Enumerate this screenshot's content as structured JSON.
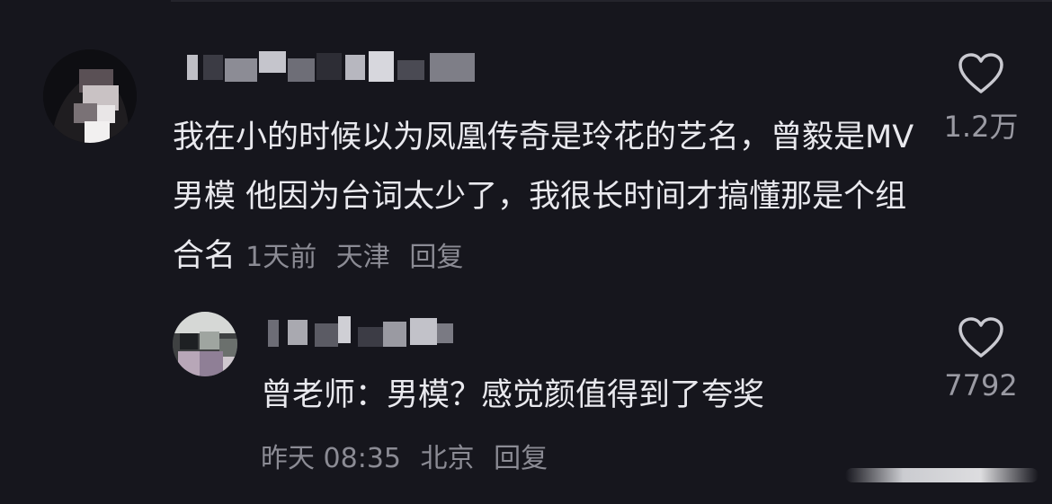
{
  "comment": {
    "text": "我在小的时候以为凤凰传奇是玲花的艺名，曾毅是MV男模 他因为台词太少了，我很长时间才搞懂那是个组合名",
    "time": "1天前",
    "location": "天津",
    "reply_label": "回复",
    "like_count": "1.2万"
  },
  "reply": {
    "text": "曾老师：男模？感觉颜值得到了夸奖",
    "time": "昨天 08:35",
    "location": "北京",
    "reply_label": "回复",
    "like_count": "7792"
  },
  "colors": {
    "background": "#16161d",
    "text": "#e9e9ee",
    "meta": "#8b8b94"
  },
  "icons": {
    "like": "heart-outline-icon"
  }
}
